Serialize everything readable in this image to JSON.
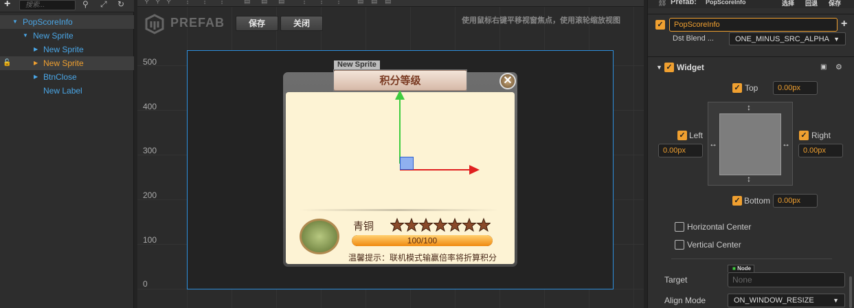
{
  "hierarchy": {
    "search_placeholder": "搜索...",
    "items": [
      {
        "label": "PopScoreInfo"
      },
      {
        "label": "New Sprite"
      },
      {
        "label": "New Sprite"
      },
      {
        "label": "New Sprite"
      },
      {
        "label": "BtnClose"
      },
      {
        "label": "New Label"
      }
    ]
  },
  "scene": {
    "brand": "PREFAB",
    "save_label": "保存",
    "close_label": "关闭",
    "hint": "使用鼠标右键平移视窗焦点，使用滚轮缩放视图",
    "y_labels": [
      "500",
      "400",
      "300",
      "200",
      "100",
      "0"
    ],
    "selected_name": "New Sprite",
    "popup": {
      "title": "积分等级",
      "rank": "青铜",
      "progress_text": "100/100",
      "progress": 1.0,
      "stars": 7,
      "tip": "温馨提示：联机模式输赢倍率将折算积分"
    }
  },
  "inspector": {
    "prefab_label": "Prefab:",
    "prefab_name": "PopScoreInfo",
    "actions": [
      "选择",
      "回退",
      "保存"
    ],
    "node_name": "PopScoreInfo",
    "dst_blend_label": "Dst Blend ...",
    "dst_blend_value": "ONE_MINUS_SRC_ALPHA",
    "widget_title": "Widget",
    "top_label": "Top",
    "top_value": "0.00px",
    "left_label": "Left",
    "left_value": "0.00px",
    "right_label": "Right",
    "right_value": "0.00px",
    "bottom_label": "Bottom",
    "bottom_value": "0.00px",
    "horizontal_center_label": "Horizontal Center",
    "vertical_center_label": "Vertical Center",
    "target_label": "Target",
    "target_tag": "Node",
    "target_value": "None",
    "align_mode_label": "Align Mode",
    "align_mode_value": "ON_WINDOW_RESIZE"
  },
  "colors": {
    "accent": "#f0a030",
    "tree_blue": "#4aa6e6",
    "selection": "#3e3e3e"
  }
}
